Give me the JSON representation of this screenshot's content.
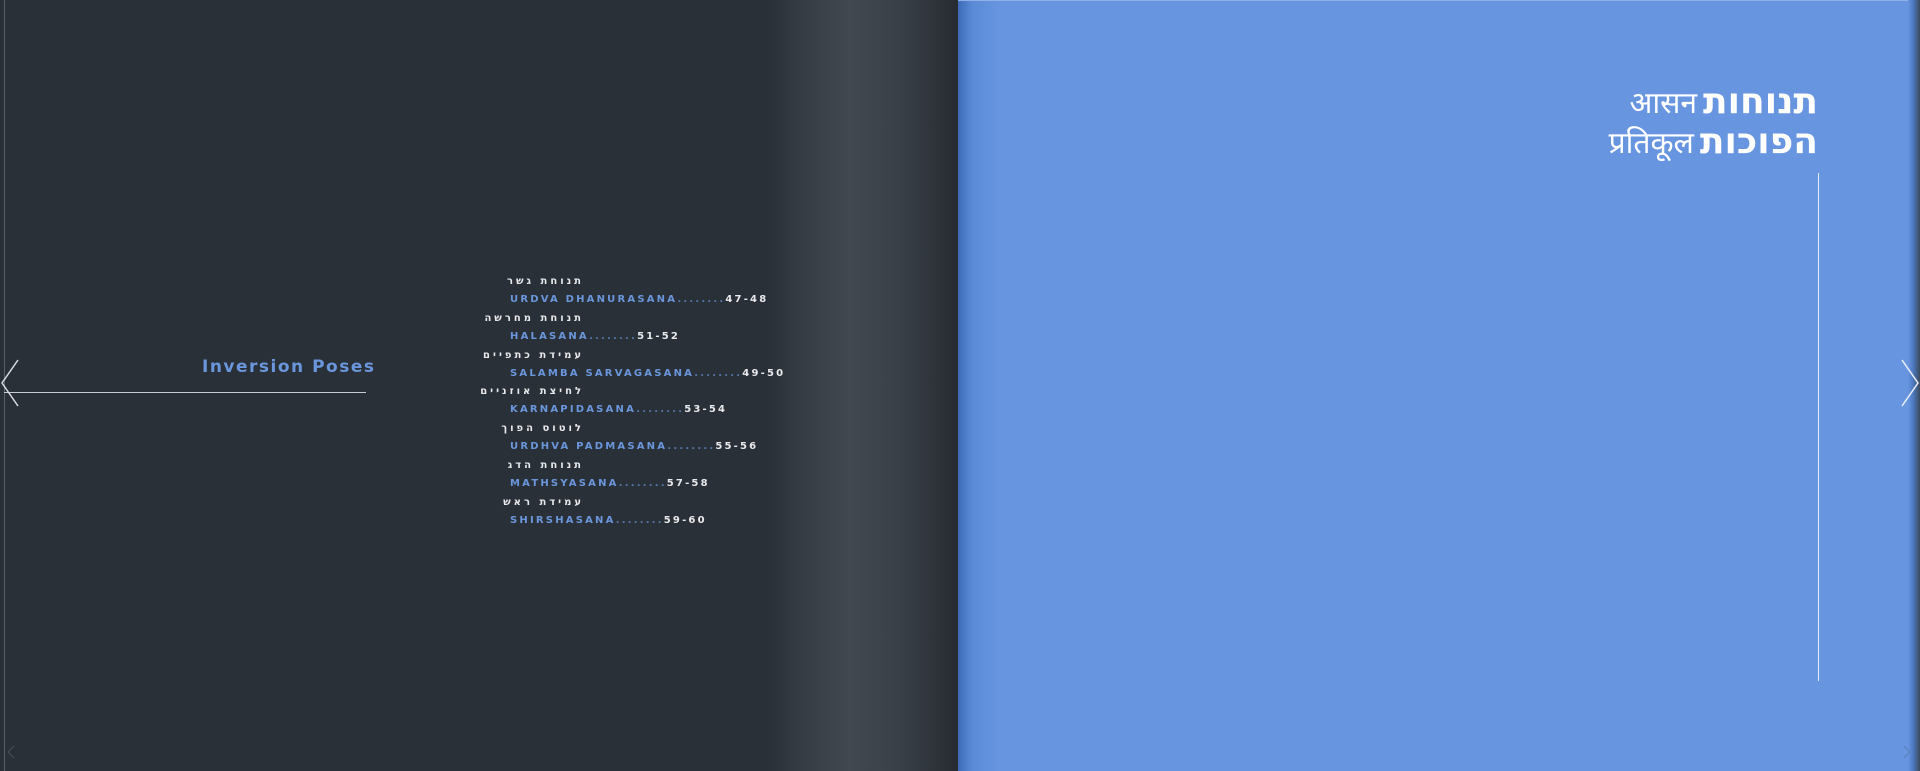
{
  "left_page": {
    "section_title": "Inversion Poses",
    "toc": [
      {
        "hebrew": "תנוחת גשר",
        "name": "URDVA DHANURASANA",
        "dots": "........",
        "pages": "47-48"
      },
      {
        "hebrew": "תנוחת מחרשה",
        "name": "HALASANA",
        "dots": "........",
        "pages": "51-52"
      },
      {
        "hebrew": "עמידת כתפיים",
        "name": "SALAMBA SARVAGASANA",
        "dots": "........",
        "pages": "49-50"
      },
      {
        "hebrew": "לחיצת אוזניים",
        "name": "KARNAPIDASANA",
        "dots": "........",
        "pages": "53-54"
      },
      {
        "hebrew": "לוטוס הפוך",
        "name": "URDHVA PADMASANA",
        "dots": "........",
        "pages": "55-56"
      },
      {
        "hebrew": "תנוחת הדג",
        "name": "MATHSYASANA",
        "dots": "........",
        "pages": "57-58"
      },
      {
        "hebrew": "עמידת ראש",
        "name": "SHIRSHASANA",
        "dots": "........",
        "pages": "59-60"
      }
    ]
  },
  "right_page": {
    "heading": {
      "line1_sanskrit": "आसन",
      "line1_hebrew": "תנוחות",
      "line2_sanskrit": "प्रतिकूल",
      "line2_hebrew": "הפוכות"
    }
  },
  "navigation": {
    "prev_icon": "chevron-left-icon",
    "next_icon": "chevron-right-icon"
  },
  "colors": {
    "left_page_bg": "#2a3038",
    "right_page_bg": "#6795e0",
    "accent_blue": "#6a96dc",
    "text_light": "#e8eaec"
  }
}
